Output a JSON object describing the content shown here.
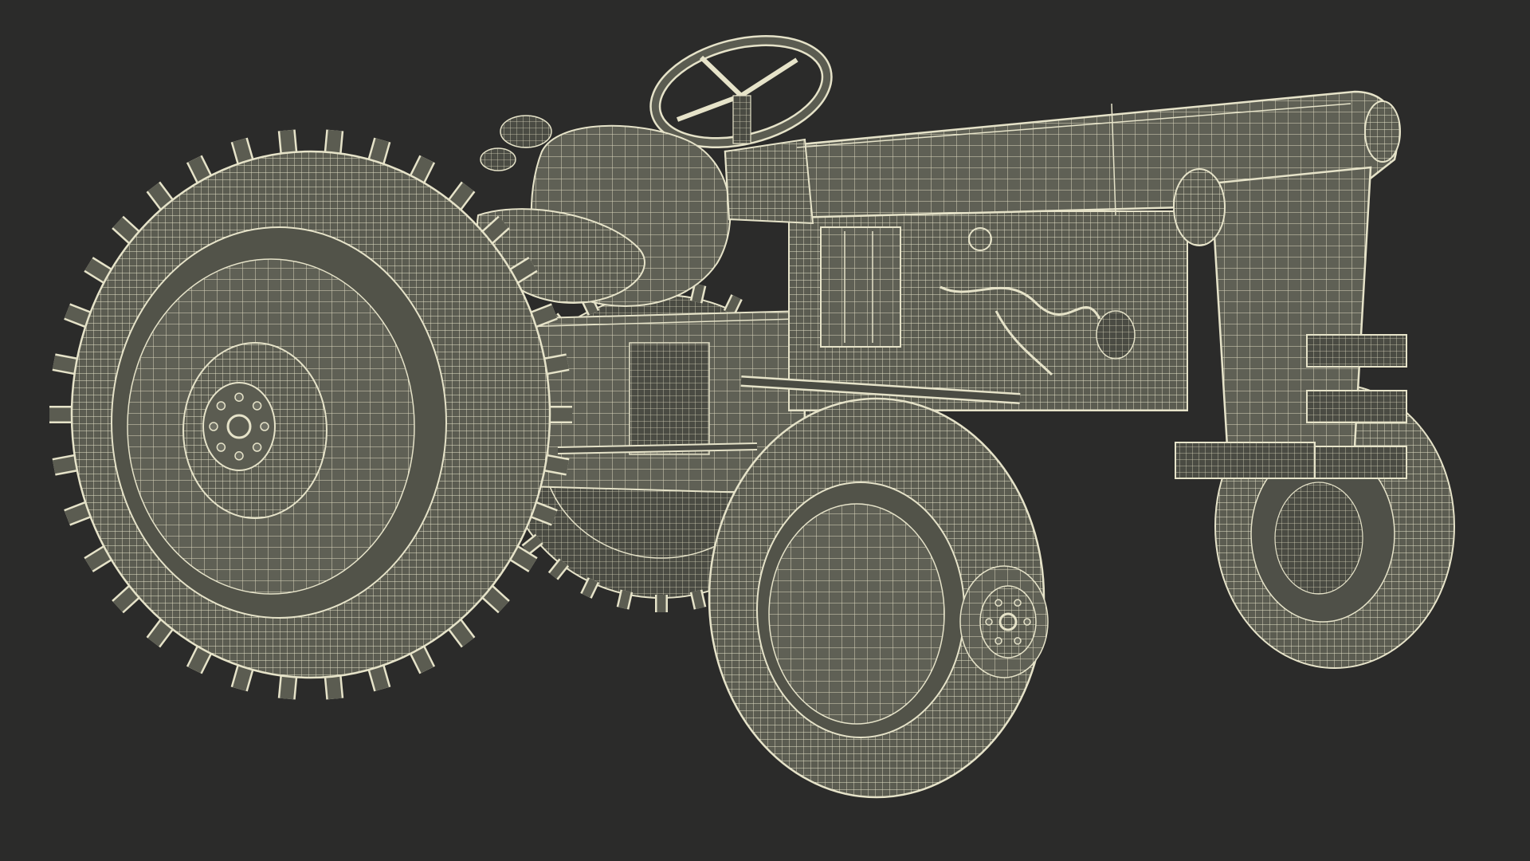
{
  "scene": {
    "subject": "tractor-wireframe-render",
    "colors": {
      "background": "#2b2b2a",
      "wire": "#e6e3c9",
      "fill": "#5b5c51",
      "fill_dark": "#45463f",
      "fill_light": "#6f7064"
    }
  }
}
